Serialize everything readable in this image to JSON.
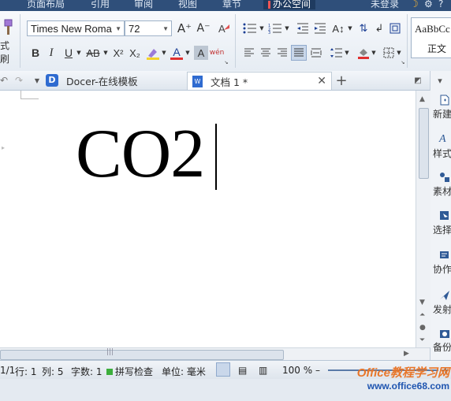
{
  "menubar": {
    "items": [
      "页面布局",
      "引用",
      "审阅",
      "视图",
      "章节",
      "办公空间"
    ],
    "login": "未登录"
  },
  "ribbon": {
    "painter_label": "式刷",
    "font_name": "Times New Roma",
    "font_size": "72",
    "grow_font": "A⁺",
    "shrink_font": "A⁻",
    "bold": "B",
    "italic": "I",
    "underline": "U",
    "strike": "AB",
    "superscript": "X²",
    "subscript": "X₂",
    "font_color_letter": "A",
    "char_shading": "A",
    "phonetic": "wén",
    "style_preview": "AaBbCc",
    "style_name": "正文",
    "accent_font_color": "#e03030",
    "accent_highlight": "#f4d22a"
  },
  "tabs": [
    {
      "label": "Docer-在线模板"
    },
    {
      "label": "文档 1 *"
    }
  ],
  "document": {
    "text": "CO2"
  },
  "side_panel": {
    "items": [
      "新建",
      "样式",
      "素材",
      "选择",
      "协作",
      "发射",
      "备份"
    ]
  },
  "status": {
    "page": "1/1",
    "row": "行: 1",
    "col": "列: 5",
    "word_count": "字数: 1",
    "spell_check": "拼写检查",
    "unit": "单位: 毫米",
    "zoom": "100 %"
  },
  "watermark": {
    "line1": "Office教程学习网",
    "line2": "www.office68.com"
  }
}
